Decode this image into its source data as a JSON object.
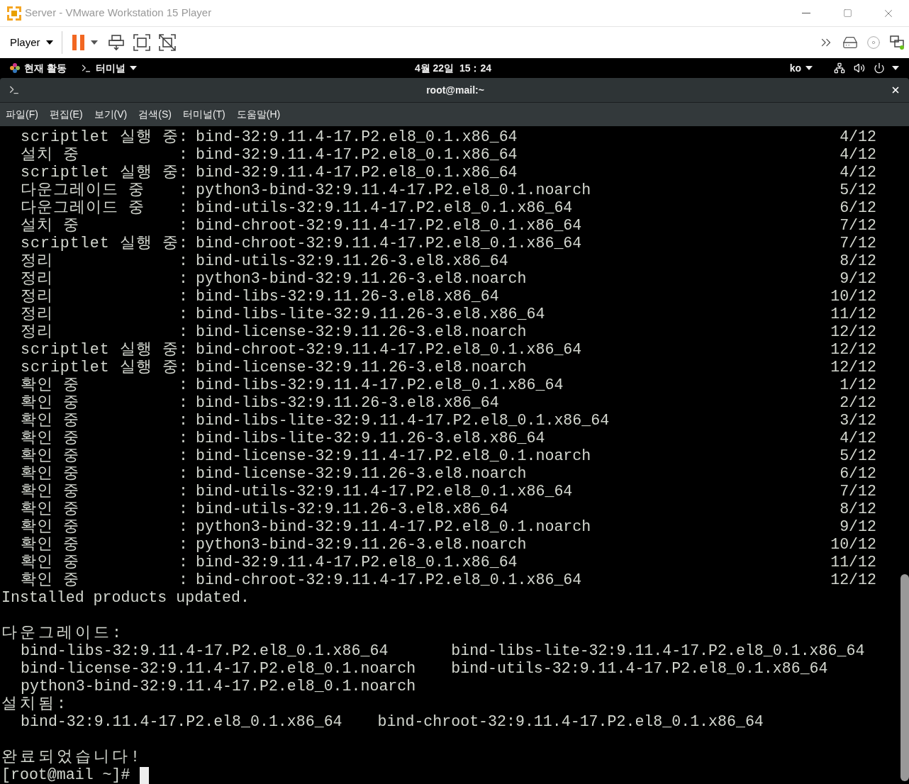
{
  "window": {
    "title": "Server - VMware Workstation 15 Player"
  },
  "toolbar": {
    "player_menu": "Player"
  },
  "top_bar": {
    "activities": "현재 활동",
    "app_menu": "터미널",
    "clock": "4월 22일  15：24",
    "input_method": "ko"
  },
  "terminal": {
    "title": "root@mail:~",
    "menu": [
      "파일(F)",
      "편집(E)",
      "보기(V)",
      "검색(S)",
      "터미널(T)",
      "도움말(H)"
    ],
    "rows": [
      {
        "label": "scriptlet 실행 중",
        "sep": ":",
        "package": "bind-32:9.11.4-17.P2.el8_0.1.x86_64",
        "count": "4/12"
      },
      {
        "label": "설치 중",
        "sep": ":",
        "package": "bind-32:9.11.4-17.P2.el8_0.1.x86_64",
        "count": "4/12"
      },
      {
        "label": "scriptlet 실행 중",
        "sep": ":",
        "package": "bind-32:9.11.4-17.P2.el8_0.1.x86_64",
        "count": "4/12"
      },
      {
        "label": "다운그레이드 중",
        "sep": ":",
        "package": "python3-bind-32:9.11.4-17.P2.el8_0.1.noarch",
        "count": "5/12"
      },
      {
        "label": "다운그레이드 중",
        "sep": ":",
        "package": "bind-utils-32:9.11.4-17.P2.el8_0.1.x86_64",
        "count": "6/12"
      },
      {
        "label": "설치 중",
        "sep": ":",
        "package": "bind-chroot-32:9.11.4-17.P2.el8_0.1.x86_64",
        "count": "7/12"
      },
      {
        "label": "scriptlet 실행 중",
        "sep": ":",
        "package": "bind-chroot-32:9.11.4-17.P2.el8_0.1.x86_64",
        "count": "7/12"
      },
      {
        "label": "정리",
        "sep": ":",
        "package": "bind-utils-32:9.11.26-3.el8.x86_64",
        "count": "8/12"
      },
      {
        "label": "정리",
        "sep": ":",
        "package": "python3-bind-32:9.11.26-3.el8.noarch",
        "count": "9/12"
      },
      {
        "label": "정리",
        "sep": ":",
        "package": "bind-libs-32:9.11.26-3.el8.x86_64",
        "count": "10/12"
      },
      {
        "label": "정리",
        "sep": ":",
        "package": "bind-libs-lite-32:9.11.26-3.el8.x86_64",
        "count": "11/12"
      },
      {
        "label": "정리",
        "sep": ":",
        "package": "bind-license-32:9.11.26-3.el8.noarch",
        "count": "12/12"
      },
      {
        "label": "scriptlet 실행 중",
        "sep": ":",
        "package": "bind-chroot-32:9.11.4-17.P2.el8_0.1.x86_64",
        "count": "12/12"
      },
      {
        "label": "scriptlet 실행 중",
        "sep": ":",
        "package": "bind-license-32:9.11.26-3.el8.noarch",
        "count": "12/12"
      },
      {
        "label": "확인 중",
        "sep": ":",
        "package": "bind-libs-32:9.11.4-17.P2.el8_0.1.x86_64",
        "count": "1/12"
      },
      {
        "label": "확인 중",
        "sep": ":",
        "package": "bind-libs-32:9.11.26-3.el8.x86_64",
        "count": "2/12"
      },
      {
        "label": "확인 중",
        "sep": ":",
        "package": "bind-libs-lite-32:9.11.4-17.P2.el8_0.1.x86_64",
        "count": "3/12"
      },
      {
        "label": "확인 중",
        "sep": ":",
        "package": "bind-libs-lite-32:9.11.26-3.el8.x86_64",
        "count": "4/12"
      },
      {
        "label": "확인 중",
        "sep": ":",
        "package": "bind-license-32:9.11.4-17.P2.el8_0.1.noarch",
        "count": "5/12"
      },
      {
        "label": "확인 중",
        "sep": ":",
        "package": "bind-license-32:9.11.26-3.el8.noarch",
        "count": "6/12"
      },
      {
        "label": "확인 중",
        "sep": ":",
        "package": "bind-utils-32:9.11.4-17.P2.el8_0.1.x86_64",
        "count": "7/12"
      },
      {
        "label": "확인 중",
        "sep": ":",
        "package": "bind-utils-32:9.11.26-3.el8.x86_64",
        "count": "8/12"
      },
      {
        "label": "확인 중",
        "sep": ":",
        "package": "python3-bind-32:9.11.4-17.P2.el8_0.1.noarch",
        "count": "9/12"
      },
      {
        "label": "확인 중",
        "sep": ":",
        "package": "python3-bind-32:9.11.26-3.el8.noarch",
        "count": "10/12"
      },
      {
        "label": "확인 중",
        "sep": ":",
        "package": "bind-32:9.11.4-17.P2.el8_0.1.x86_64",
        "count": "11/12"
      },
      {
        "label": "확인 중",
        "sep": ":",
        "package": "bind-chroot-32:9.11.4-17.P2.el8_0.1.x86_64",
        "count": "12/12"
      }
    ],
    "status": "Installed products updated.",
    "sections": [
      {
        "heading": "다운그레이드:",
        "columns": [
          [
            "bind-libs-32:9.11.4-17.P2.el8_0.1.x86_64",
            "bind-license-32:9.11.4-17.P2.el8_0.1.noarch",
            "python3-bind-32:9.11.4-17.P2.el8_0.1.noarch"
          ],
          [
            "bind-libs-lite-32:9.11.4-17.P2.el8_0.1.x86_64",
            "bind-utils-32:9.11.4-17.P2.el8_0.1.x86_64"
          ]
        ]
      },
      {
        "heading": "설치됨:",
        "columns": [
          [
            "bind-32:9.11.4-17.P2.el8_0.1.x86_64"
          ],
          [
            "bind-chroot-32:9.11.4-17.P2.el8_0.1.x86_64"
          ]
        ]
      }
    ],
    "done": "완료되었습니다!",
    "prompt": "[root@mail ~]#"
  }
}
